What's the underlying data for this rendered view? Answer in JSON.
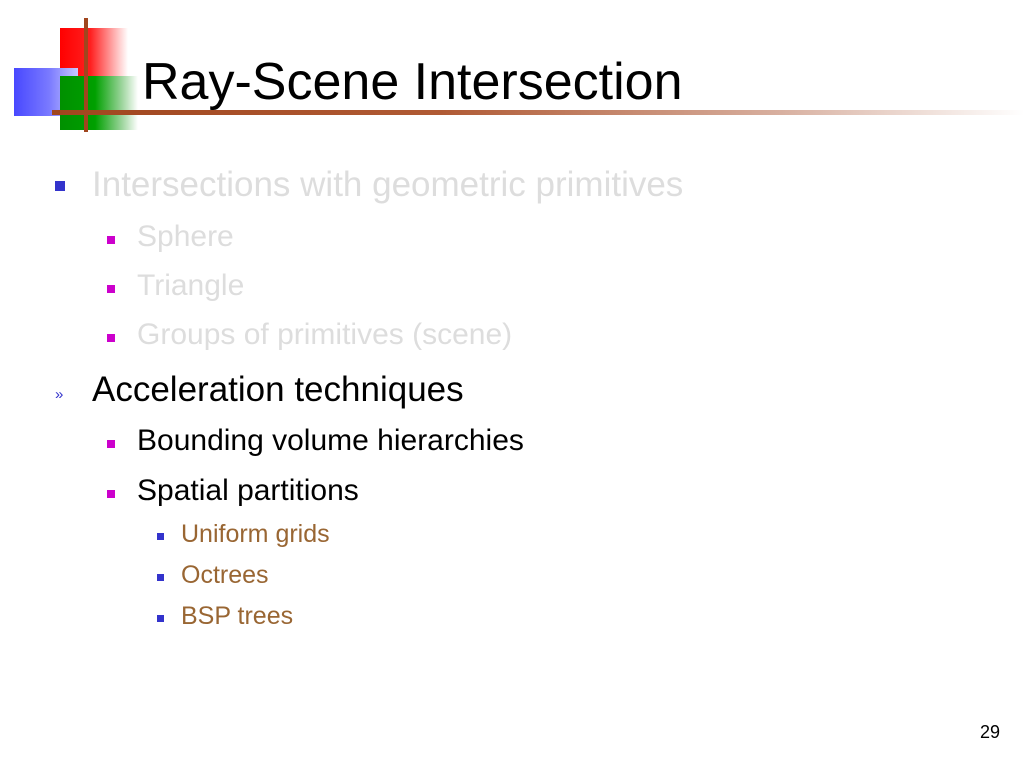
{
  "slide": {
    "title": "Ray-Scene Intersection",
    "page_number": "29",
    "bullets": {
      "intersections": {
        "label": "Intersections with geometric primitives",
        "sub": [
          "Sphere",
          "Triangle",
          "Groups of primitives (scene)"
        ]
      },
      "acceleration": {
        "label": "Acceleration techniques",
        "sub": [
          "Bounding volume hierarchies",
          "Spatial partitions"
        ],
        "spatial_sub": [
          "Uniform grids",
          "Octrees",
          "BSP trees"
        ]
      }
    },
    "colors": {
      "title_text": "#000000",
      "dimmed_text": "#dddddd",
      "active_text": "#000000",
      "level3_text": "#996633",
      "bullet_blue": "#3333cc",
      "bullet_magenta": "#cc00cc",
      "accent_line": "#a0461e"
    },
    "icons": {
      "level1_bullet": "square-bullet-icon",
      "current_marker": "double-chevron-icon",
      "level2_bullet": "square-bullet-icon",
      "level3_bullet": "square-bullet-icon"
    },
    "current_marker_glyph": "»"
  }
}
